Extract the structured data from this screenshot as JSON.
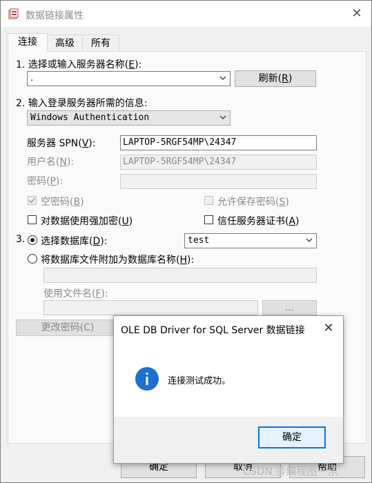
{
  "window": {
    "title": "数据链接属性",
    "close_glyph": "✕"
  },
  "tabs": [
    {
      "label": "连接",
      "active": true
    },
    {
      "label": "高级",
      "active": false
    },
    {
      "label": "所有",
      "active": false
    }
  ],
  "step1": {
    "label": "1. 选择或输入服务器名称(",
    "hotkey": "E",
    "label_end": "):",
    "value": ".",
    "refresh_label": "刷新(",
    "refresh_hotkey": "R",
    "refresh_end": ")"
  },
  "step2": {
    "label": "2. 输入登录服务器所需的信息:",
    "auth_value": "Windows Authentication",
    "spn_label": "服务器 SPN(",
    "spn_hotkey": "V",
    "spn_end": "):",
    "spn_value": "LAPTOP-5RGF54MP\\24347",
    "user_label": "用户名(",
    "user_hotkey": "N",
    "user_end": "):",
    "user_value": "LAPTOP-5RGF54MP\\24347",
    "pwd_label": "密码(",
    "pwd_hotkey": "P",
    "pwd_end": "):",
    "blank_pwd_label": "空密码(",
    "blank_pwd_hotkey": "B",
    "blank_pwd_end": ")",
    "save_pwd_label": "允许保存密码(",
    "save_pwd_hotkey": "S",
    "save_pwd_end": ")",
    "encrypt_label": "对数据使用强加密(",
    "encrypt_hotkey": "U",
    "encrypt_end": ")",
    "trust_label": "信任服务器证书(",
    "trust_hotkey": "A",
    "trust_end": ")"
  },
  "step3": {
    "number": "3.",
    "select_db_label": "选择数据库(",
    "select_db_hotkey": "D",
    "select_db_end": "):",
    "db_value": "test",
    "attach_label": "将数据库文件附加为数据库名称(",
    "attach_hotkey": "H",
    "attach_end": "):",
    "filename_label": "使用文件名(",
    "filename_hotkey": "F",
    "filename_end": "):",
    "browse_label": "...",
    "change_pwd_label": "更改密码(C)"
  },
  "bottom": {
    "ok": "确定",
    "cancel": "取消",
    "help": "帮助"
  },
  "modal": {
    "title": "OLE DB Driver for SQL Server 数据链接",
    "message": "连接测试成功。",
    "ok": "确定",
    "close_glyph": "✕",
    "icon": "info-icon"
  },
  "watermark": "CSDN @编程图一乐",
  "colors": {
    "accent": "#0078d7",
    "info_icon": "#1e6fd0"
  }
}
